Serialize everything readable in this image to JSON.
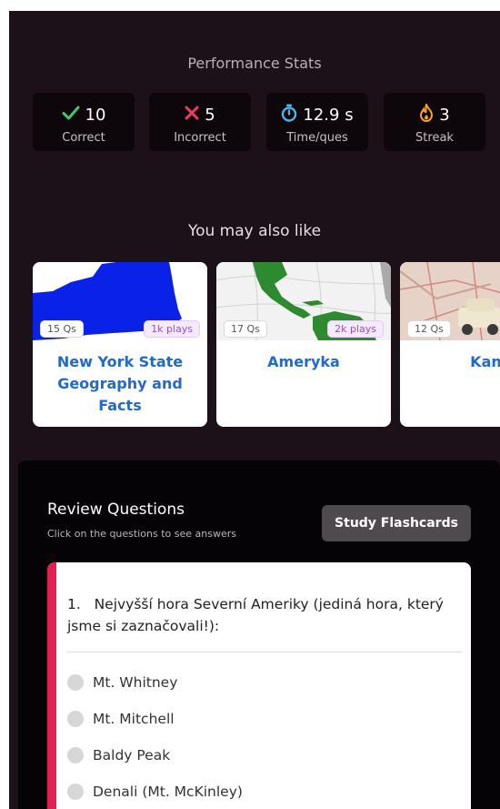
{
  "performance": {
    "title": "Performance Stats",
    "stats": [
      {
        "icon": "check-icon",
        "value": "10",
        "label": "Correct",
        "color": "#4ac46c"
      },
      {
        "icon": "cross-icon",
        "value": "5",
        "label": "Incorrect",
        "color": "#ef3b5f"
      },
      {
        "icon": "stopwatch-icon",
        "value": "12.9 s",
        "label": "Time/ques",
        "color": "#4fb4ec"
      },
      {
        "icon": "flame-icon",
        "value": "3",
        "label": "Streak",
        "color": "#f5a623"
      }
    ]
  },
  "recommendations": {
    "title": "You may also like",
    "cards": [
      {
        "questions": "15 Qs",
        "plays": "1k plays",
        "name": "New York State Geography and Facts"
      },
      {
        "questions": "17 Qs",
        "plays": "2k plays",
        "name": "Ameryka"
      },
      {
        "questions": "12 Qs",
        "plays": "",
        "name": "Kanada"
      }
    ]
  },
  "review": {
    "title": "Review Questions",
    "subtitle": "Click on the questions to see answers",
    "flashcards_label": "Study Flashcards",
    "question": {
      "text": "1.   Nejvyšší hora Severní Ameriky (jediná hora, který jsme si zaznačovali!):",
      "options": [
        "Mt. Whitney",
        "Mt. Mitchell",
        "Baldy Peak",
        "Denali (Mt. McKinley)"
      ]
    }
  },
  "colors": {
    "background": "#1d1119",
    "accent": "#e2204f",
    "link": "#2369c6"
  }
}
